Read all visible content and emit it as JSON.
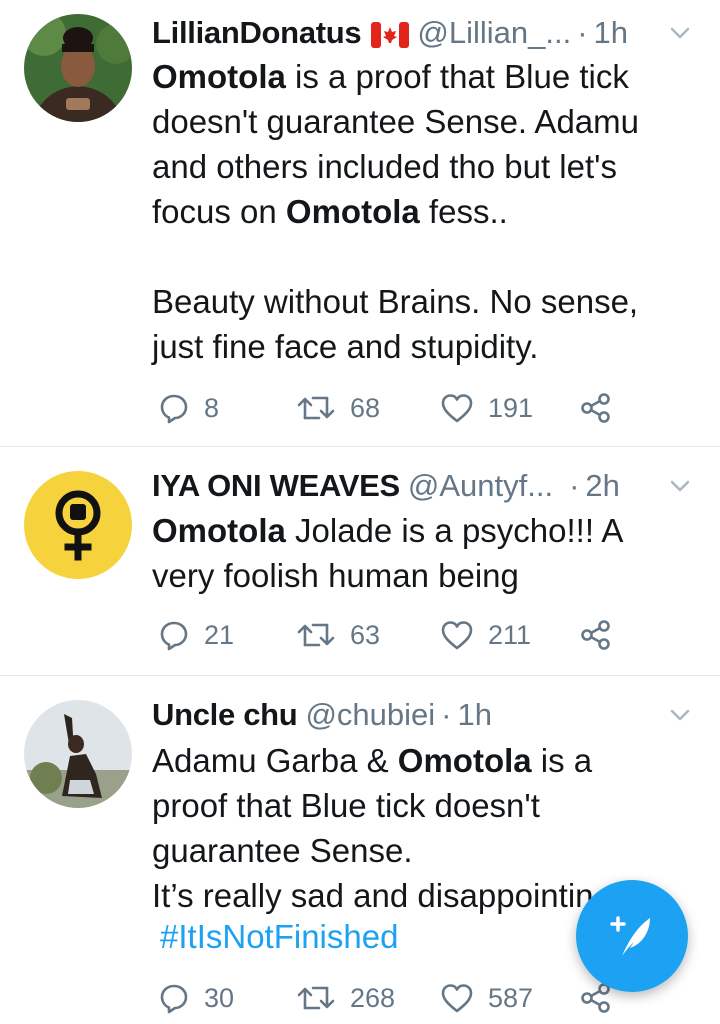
{
  "tweets": [
    {
      "name": "LillianDonatus",
      "handle": "@Lillian_...",
      "time": "1h",
      "body_html": "<b>Omotola</b> is a proof that Blue tick doesn't guarantee Sense. Adamu and others included tho but let's focus on <b>Omotola</b> fess..\n\nBeauty without Brains. No sense, just fine face and stupidity.",
      "replies": "8",
      "retweets": "68",
      "likes": "191"
    },
    {
      "name": "IYA ONI WEAVES",
      "handle": "@Auntyf...",
      "time": "2h",
      "body_html": "<b>Omotola</b> Jolade is a psycho!!! A very foolish human being",
      "replies": "21",
      "retweets": "63",
      "likes": "211"
    },
    {
      "name": "Uncle chu",
      "handle": "@chubiei",
      "time": "1h",
      "body_html": "Adamu Garba &amp; <b>Omotola</b> is a proof that Blue tick doesn't guarantee Sense.\nIt’s really sad and disappointin",
      "hashtag": "#ItIsNotFinished",
      "replies": "30",
      "retweets": "268",
      "likes": "587"
    }
  ],
  "icons": {
    "flag": "canada-flag-icon",
    "chevron": "chevron-down-icon",
    "reply": "reply-icon",
    "retweet": "retweet-icon",
    "like": "heart-icon",
    "share": "share-icon",
    "compose": "compose-tweet-icon"
  },
  "colors": {
    "accent": "#1da1f2",
    "secondary_text": "#657786",
    "separator": "#e1e8ed"
  }
}
